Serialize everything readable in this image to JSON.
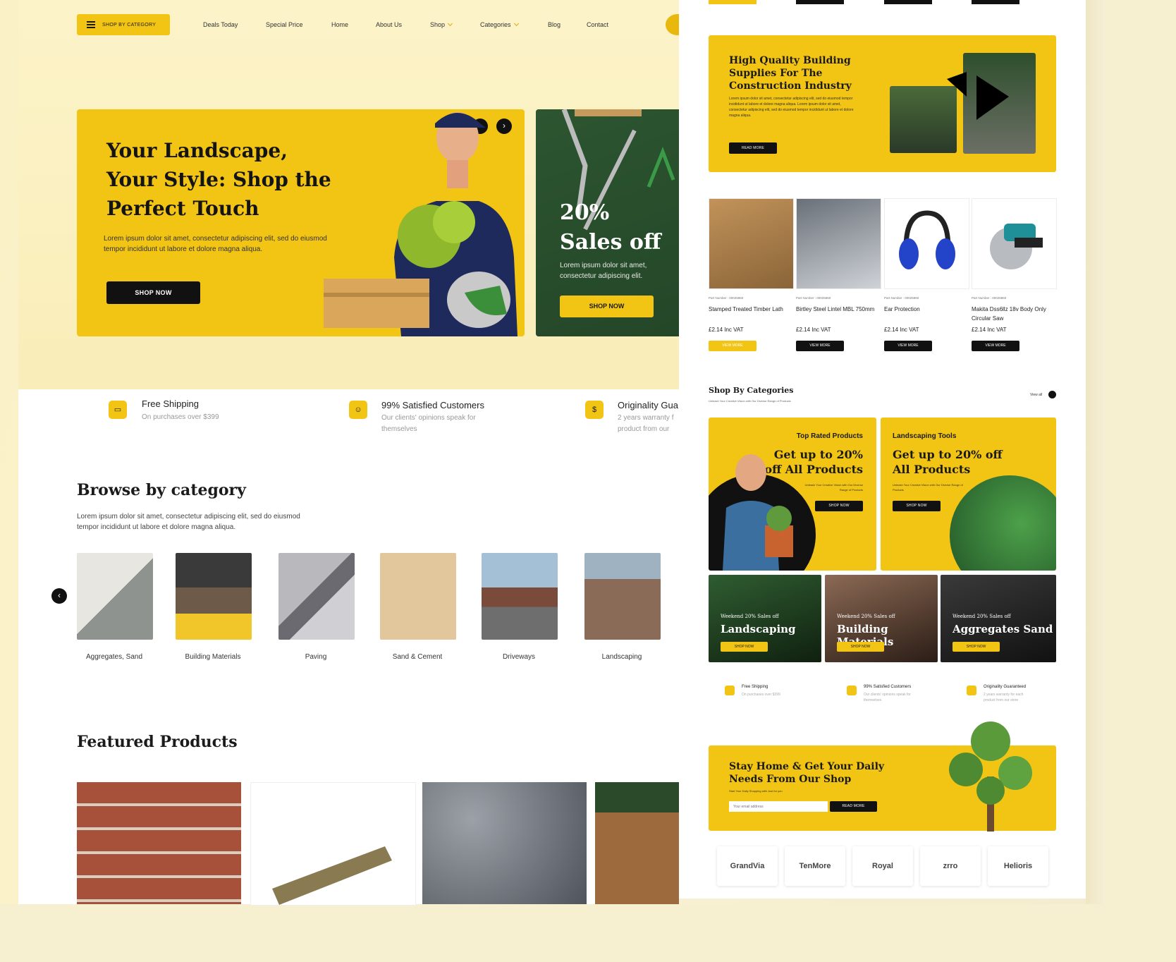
{
  "nav": {
    "shop_by_category": "SHOP BY CATEGORY",
    "items": [
      "Deals Today",
      "Special Price",
      "Home",
      "About Us",
      "Shop",
      "Categories",
      "Blog",
      "Contact"
    ]
  },
  "hero": {
    "title": "Your Landscape, Your Style: Shop the Perfect Touch",
    "text": "Lorem ipsum dolor sit amet, consectetur adipiscing elit, sed do eiusmod tempor incididunt ut labore et dolore magna aliqua.",
    "button": "SHOP NOW",
    "prev": "‹",
    "next": "›"
  },
  "sale": {
    "title": "20% Sales off",
    "text": "Lorem ipsum dolor sit amet, consectetur adipiscing elit.",
    "button": "SHOP NOW"
  },
  "features": [
    {
      "title": "Free Shipping",
      "sub": "On purchases over $399"
    },
    {
      "title": "99% Satisfied Customers",
      "sub": "Our clients' opinions speak for themselves"
    },
    {
      "title": "Originality Gua",
      "sub": "2 years warranty f product from our"
    }
  ],
  "browse": {
    "title": "Browse by category",
    "text": "Lorem ipsum dolor sit amet, consectetur adipiscing elit, sed do eiusmod tempor incididunt ut labore et dolore magna aliqua.",
    "prev": "‹",
    "categories": [
      "Aggregates, Sand",
      "Building Materials",
      "Paving",
      "Sand & Cement",
      "Driveways",
      "Landscaping"
    ]
  },
  "featured": {
    "title": "Featured Products"
  },
  "quality": {
    "title": "High Quality Building Supplies For The Construction Industry",
    "text": "Lorem ipsum dolor sit amet, consectetur adipiscing elit, sed do eiusmod tempor incididunt ut labore et dolore magna aliqua. Lorem ipsum dolor sit amet, consectetur adipiscing elit, sed do eiusmod tempor incididunt ut labore et dolore magna aliqua.",
    "button": "READ MORE"
  },
  "products": [
    {
      "part": "Part Number : 00025860",
      "name": "Stamped Treated Timber Lath",
      "price": "£2.14 Inc VAT",
      "button": "VIEW MORE"
    },
    {
      "part": "Part Number : 00025860",
      "name": "Birtley Steel Lintel MBL 750mm",
      "price": "£2.14 Inc VAT",
      "button": "VIEW MORE"
    },
    {
      "part": "Part Number : 00025860",
      "name": "Ear Protection",
      "price": "£2.14 Inc VAT",
      "button": "VIEW MORE"
    },
    {
      "part": "Part Number : 00025860",
      "name": "Makita Dss6llz 18v Body Only Circular Saw",
      "price": "£2.14 Inc VAT",
      "button": "VIEW MORE"
    }
  ],
  "shop_categories": {
    "title": "Shop By Categories",
    "sub": "Unleash Your Creative Vision with Our Diverse Range of Products",
    "view_all": "View all"
  },
  "promo_cards": [
    {
      "kicker": "Top Rated Products",
      "title": "Get up to 20% off All Products",
      "sub": "Unleash Your Creative Vision with Our Diverse Range of Products",
      "button": "SHOP NOW"
    },
    {
      "kicker": "Landscaping Tools",
      "title": "Get up to 20% off All Products",
      "sub": "Unleash Your Creative Vision with Our Diverse Range of Products",
      "button": "SHOP NOW"
    }
  ],
  "weekend_tiles": [
    {
      "kicker": "Weekend 20% Sales off",
      "title": "Landscaping",
      "button": "SHOP NOW"
    },
    {
      "kicker": "Weekend 20% Sales off",
      "title": "Building Materials",
      "button": "SHOP NOW"
    },
    {
      "kicker": "Weekend 20% Sales off",
      "title": "Aggregates Sand",
      "button": "SHOP NOW"
    }
  ],
  "right_features": [
    {
      "title": "Free Shipping",
      "sub": "On purchases over $399"
    },
    {
      "title": "99% Satisfied Customers",
      "sub": "Our clients' opinions speak for themselves"
    },
    {
      "title": "Originality Guaranteed",
      "sub": "2 years warranty for each product from our store"
    }
  ],
  "newsletter": {
    "title": "Stay Home & Get Your Daily Needs From Our Shop",
    "sub": "Start Your Daily Shopping with Just for you",
    "placeholder": "Your email address",
    "button": "READ MORE"
  },
  "brands": [
    "GrandVia",
    "TenMore",
    "Royal",
    "zrro",
    "Helioris"
  ],
  "colors": {
    "accent": "#f2c413",
    "dark": "#111111"
  }
}
